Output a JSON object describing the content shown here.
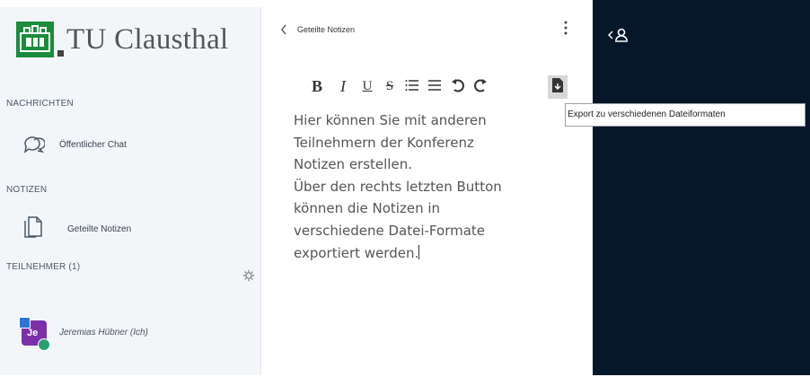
{
  "top_caption": "",
  "logo": {
    "text": "TU Clausthal"
  },
  "sidebar": {
    "messages": {
      "title": "NACHRICHTEN",
      "items": [
        {
          "label": "Öffentlicher Chat",
          "icon": "chat-bubbles-icon"
        }
      ]
    },
    "notes": {
      "title": "NOTIZEN",
      "items": [
        {
          "label": "Geteilte Notizen",
          "icon": "document-icon"
        }
      ]
    },
    "participants": {
      "title": "TEILNEHMER (1)",
      "gear_icon": "gear-icon",
      "users": [
        {
          "initials": "Je",
          "name": "Jeremias Hübner (Ich)",
          "color": "#7b2fa8"
        }
      ]
    }
  },
  "notes_panel": {
    "title": "Geteilte Notizen",
    "toolbar": [
      {
        "name": "bold",
        "glyph": "B"
      },
      {
        "name": "italic",
        "glyph": "I"
      },
      {
        "name": "underline",
        "glyph": "U"
      },
      {
        "name": "strikethrough",
        "glyph": "S"
      },
      {
        "name": "ordered-list",
        "glyph": "≡"
      },
      {
        "name": "unordered-list",
        "glyph": "≡"
      },
      {
        "name": "undo",
        "glyph": "↶"
      },
      {
        "name": "redo",
        "glyph": "↷"
      },
      {
        "name": "export",
        "glyph": "⇩"
      }
    ],
    "content": "Hier können Sie mit anderen\nTeilnehmern der Konferenz\nNotizen erstellen.\nÜber den rechts letzten Button\nkönnen die Notizen in\nverschiedene Datei-Formate\nexportiert werden."
  },
  "tooltip": {
    "text": "Export zu verschiedenen Dateiformaten"
  },
  "colors": {
    "dark_panel": "#06172a",
    "logo_green": "#1a8c3c",
    "sidebar_bg": "#f3f6f9"
  }
}
